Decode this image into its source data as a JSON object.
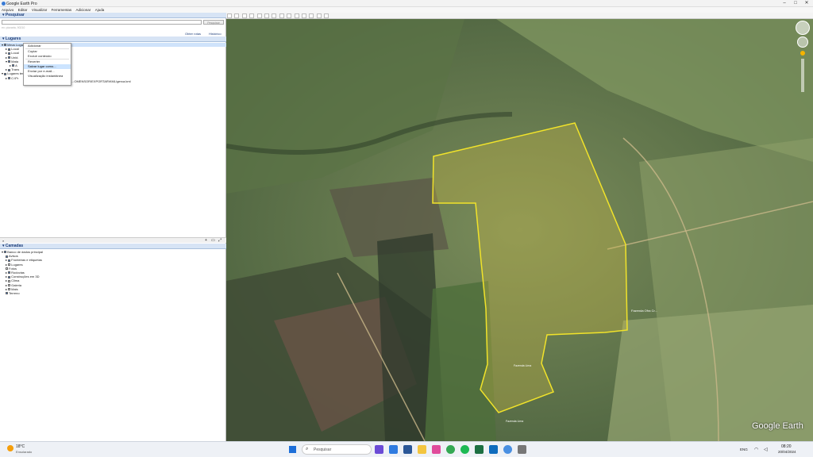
{
  "window": {
    "title": "Google Earth Pro"
  },
  "menu": [
    "Arquivo",
    "Editar",
    "Visualizar",
    "Ferramentas",
    "Adicionar",
    "Ajuda"
  ],
  "search": {
    "panel_title": "Pesquisar",
    "button": "Pesquisar",
    "hint": "ex: pizzaria, 90210"
  },
  "places": {
    "panel_title": "Lugares",
    "links": [
      "Obter rotas",
      "Histórico"
    ],
    "items": [
      "Meus Lugares",
      "Local",
      "Local",
      "Unid.",
      "Mata",
      "A",
      "Trans",
      "Lugares temporários",
      "C:\\Pr"
    ],
    "path_suffix": "...OMENSOR\\EXPORTAR\\KML\\gerca.kml"
  },
  "context_menu": {
    "items": [
      "Adicionar",
      "Copiar",
      "Excluir conteúdo",
      "Reverter",
      "Salvar lugar como...",
      "Enviar por e-mail...",
      "Visualização instantânea"
    ],
    "selected": "Salvar lugar como..."
  },
  "layers": {
    "panel_title": "Camadas",
    "items": [
      "Banco de dados principal",
      "Avisos",
      "Fronteiras e etiquetas",
      "Lugares",
      "Fotos",
      "Rodovias",
      "Construções em 3D",
      "Clima",
      "Galeria",
      "Mais",
      "Terreno"
    ]
  },
  "map": {
    "labels": [
      "Fazenda Ofra Cr...",
      "Fazenda Lima",
      "Fazenda Lima"
    ],
    "watermark": "Google Earth",
    "polygon_color": "#f1e32a"
  },
  "taskbar": {
    "weather_temp": "18°C",
    "weather_text": "Ensolarado",
    "search_placeholder": "Pesquisar",
    "lang": "ENG",
    "time": "08:20",
    "date": "20/04/2024"
  }
}
